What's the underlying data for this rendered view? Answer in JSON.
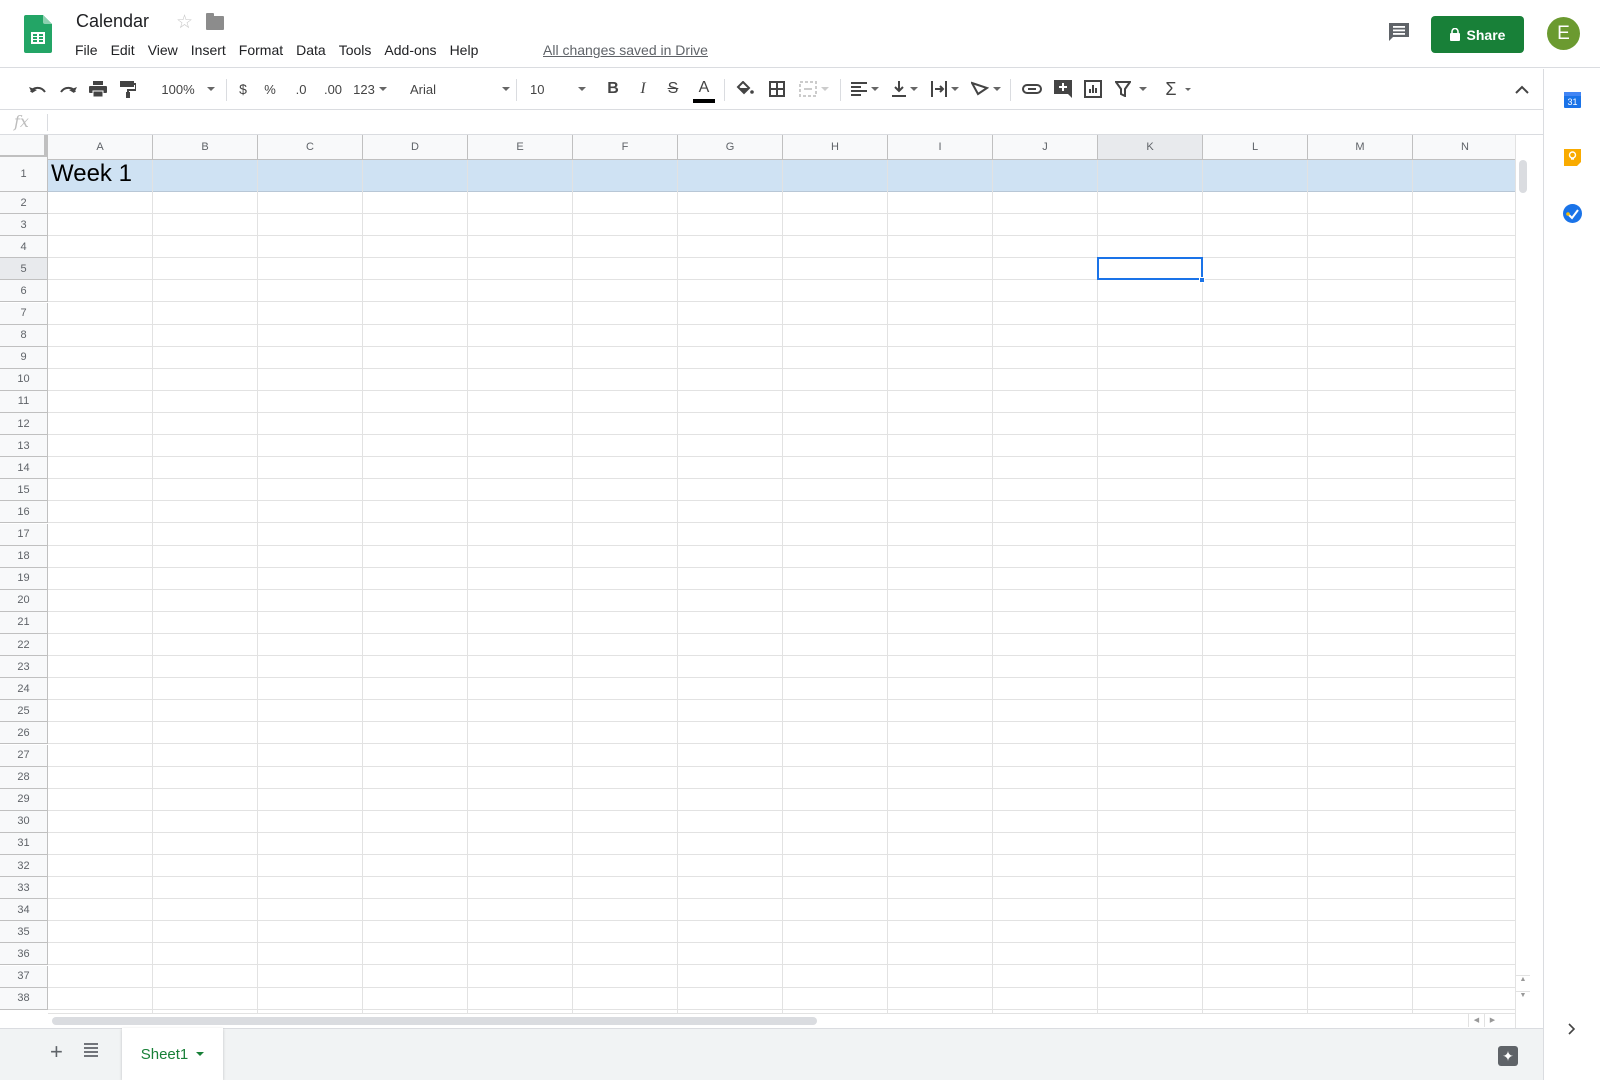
{
  "app": {
    "title": "Calendar",
    "menu": [
      "File",
      "Edit",
      "View",
      "Insert",
      "Format",
      "Data",
      "Tools",
      "Add-ons",
      "Help"
    ],
    "save_status": "All changes saved in Drive",
    "share_label": "Share",
    "avatar_initial": "E",
    "brand_color": "#188038"
  },
  "toolbar": {
    "zoom": "100%",
    "currency": "$",
    "percent": "%",
    "dec_decrease": ".0",
    "dec_increase": ".00",
    "more_formats": "123",
    "font": "Arial",
    "font_size": "10",
    "bold": "B",
    "italic": "I",
    "strike": "S",
    "text_color": "A",
    "sum": "Σ"
  },
  "formula_bar": {
    "fx": "fx",
    "value": ""
  },
  "grid": {
    "columns": [
      "A",
      "B",
      "C",
      "D",
      "E",
      "F",
      "G",
      "H",
      "I",
      "J",
      "K",
      "L",
      "M",
      "N"
    ],
    "rows": [
      "1",
      "2",
      "3",
      "4",
      "5",
      "6",
      "7",
      "8",
      "9",
      "10",
      "11",
      "12",
      "13",
      "14",
      "15",
      "16",
      "17",
      "18",
      "19",
      "20",
      "21",
      "22",
      "23",
      "24",
      "25",
      "26",
      "27",
      "28",
      "29",
      "30",
      "31",
      "32",
      "33",
      "34",
      "35",
      "36",
      "37",
      "38"
    ],
    "cells": {
      "A1": "Week 1"
    },
    "selected_cell": "K5",
    "highlighted_row": "1",
    "highlight_color": "#cfe2f3"
  },
  "sheets": {
    "tabs": [
      {
        "label": "Sheet1",
        "active": true
      }
    ]
  },
  "side_panel": {
    "apps": [
      "calendar-icon",
      "keep-icon",
      "tasks-icon"
    ]
  }
}
